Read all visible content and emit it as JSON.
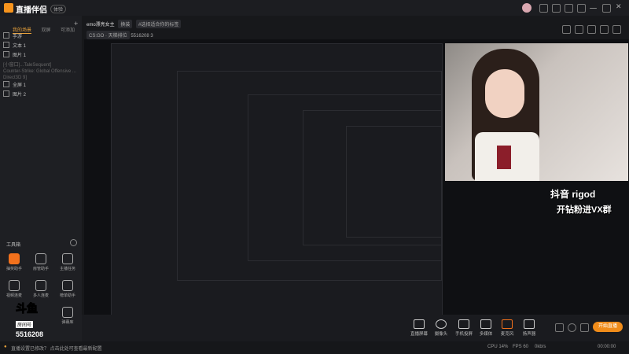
{
  "app": {
    "logo_text": "直播伴侣",
    "version": "体验"
  },
  "sidebar": {
    "tabs": [
      "我的场景",
      "双屏",
      "可添加"
    ],
    "sources": [
      {
        "label": "手游"
      },
      {
        "label": "文本 1"
      },
      {
        "label": "图片 1"
      },
      {
        "label": "[小窗口]...TaleSequent]"
      },
      {
        "label": "Counter-Strike: Global Offensive ... Direct3D 9]"
      },
      {
        "label": "全屏 1"
      },
      {
        "label": "图片 2"
      }
    ],
    "toolbox_label": "工具箱",
    "tools": [
      {
        "label": "抽奖助手"
      },
      {
        "label": "房管助手"
      },
      {
        "label": "主播任务"
      },
      {
        "label": "视频连麦"
      },
      {
        "label": "多人连麦"
      },
      {
        "label": "榜单助手"
      },
      {
        "label": "弹幕库"
      }
    ]
  },
  "stream_meta": {
    "title": "emo漂亮女主",
    "tag1": "换装",
    "tag2": "#选择适合你的标签",
    "category": "CS:GO · 天梯排位",
    "uid": "5516208",
    "viewers": "3"
  },
  "overlay": {
    "line1": "抖音 rigod",
    "line2": "开钻粉进VX群",
    "logo_name": "斗鱼",
    "room_label": "房间号",
    "room_number": "5516208"
  },
  "bottombar": {
    "buttons": [
      "直播屏幕",
      "摄像头",
      "手机投屏",
      "多媒体",
      "麦克风",
      "扬声器"
    ],
    "live_label": "开始直播"
  },
  "status": {
    "warning": "直播设置已修改？ 点击此处可查看最新配置",
    "cpu": "CPU 14%",
    "fps": "FPS 60",
    "bitrate": "0kb/s",
    "time": "00:00:00"
  },
  "colors": {
    "accent": "#f08c1a",
    "bg": "#17181b"
  }
}
